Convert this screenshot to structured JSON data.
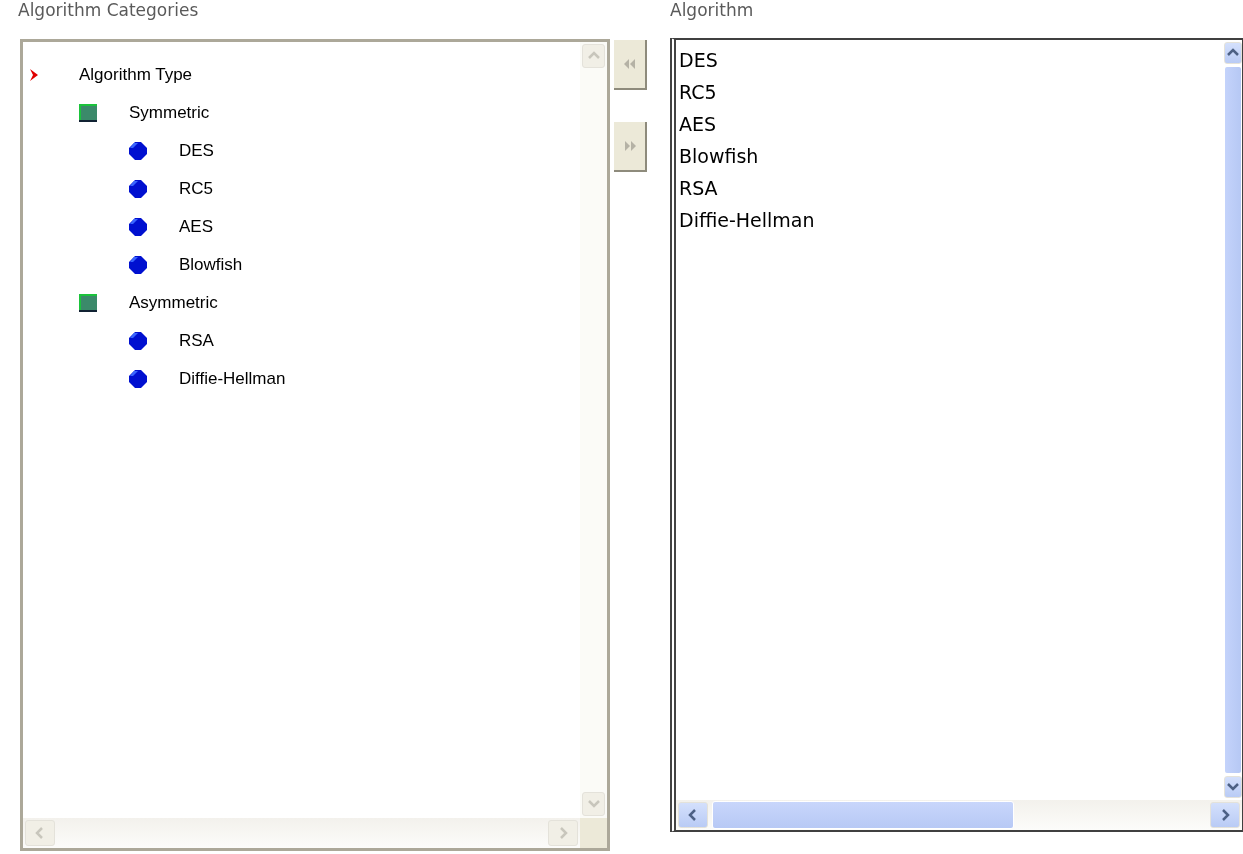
{
  "categories_panel": {
    "title": "Algorithm Categories",
    "tree": [
      {
        "label": "Algorithm Type",
        "kind": "root",
        "children": [
          {
            "label": "Symmetric",
            "kind": "category",
            "children": [
              {
                "label": "DES",
                "kind": "leaf"
              },
              {
                "label": "RC5",
                "kind": "leaf"
              },
              {
                "label": "AES",
                "kind": "leaf"
              },
              {
                "label": "Blowfish",
                "kind": "leaf"
              }
            ]
          },
          {
            "label": "Asymmetric",
            "kind": "category",
            "children": [
              {
                "label": "RSA",
                "kind": "leaf"
              },
              {
                "label": "Diffie-Hellman",
                "kind": "leaf"
              }
            ]
          }
        ]
      }
    ]
  },
  "move_buttons": [
    {
      "kind": "remove",
      "disabled": true
    },
    {
      "kind": "add",
      "disabled": true
    }
  ],
  "algorithm_panel": {
    "title": "Algorithm",
    "items": [
      {
        "label": "DES",
        "selected": false
      },
      {
        "label": "RC5",
        "selected": false
      },
      {
        "label": "AES",
        "selected": false
      },
      {
        "label": "Blowfish",
        "selected": false
      },
      {
        "label": "RSA",
        "selected": false
      },
      {
        "label": "Diffie-Hellman",
        "selected": false
      }
    ]
  }
}
